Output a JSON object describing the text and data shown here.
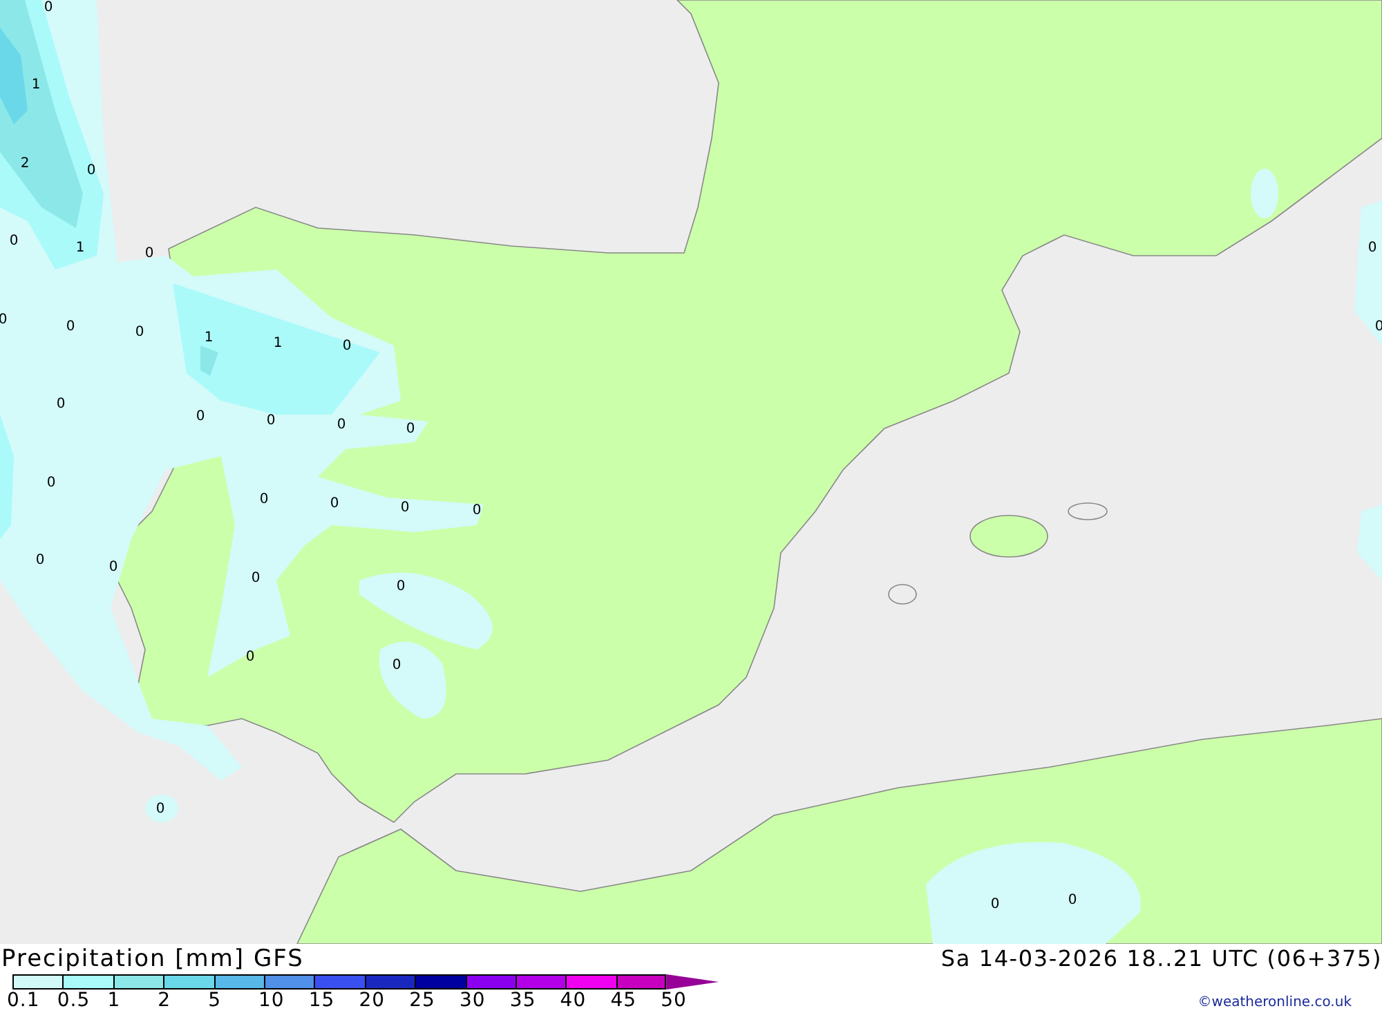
{
  "map": {
    "contour_labels": [
      "0",
      "1",
      "2",
      "0",
      "0",
      "1",
      "0",
      "0",
      "0",
      "0",
      "1",
      "1",
      "0",
      "0",
      "0",
      "0",
      "0",
      "0",
      "0",
      "0",
      "0",
      "0",
      "0",
      "0",
      "0",
      "0",
      "0",
      "0",
      "0",
      "0",
      "0",
      "0",
      "0",
      "0"
    ]
  },
  "legend": {
    "title": "Precipitation [mm] GFS",
    "valid_time": "Sa 14-03-2026 18..21 UTC (06+375)",
    "credit": "©weatheronline.co.uk",
    "classes": [
      {
        "label": "0.1",
        "color": "#d2f8f8"
      },
      {
        "label": "0.5",
        "color": "#aafafa"
      },
      {
        "label": "1",
        "color": "#8ce8e8"
      },
      {
        "label": "2",
        "color": "#6ad8e8"
      },
      {
        "label": "5",
        "color": "#58b8e8"
      },
      {
        "label": "10",
        "color": "#5090e8"
      },
      {
        "label": "15",
        "color": "#3a50f0"
      },
      {
        "label": "20",
        "color": "#1a28c0"
      },
      {
        "label": "25",
        "color": "#0000a0"
      },
      {
        "label": "30",
        "color": "#8c00f0"
      },
      {
        "label": "35",
        "color": "#b400e8"
      },
      {
        "label": "40",
        "color": "#f000f0"
      },
      {
        "label": "45",
        "color": "#c800c0"
      },
      {
        "label": "50",
        "color": "#960096"
      }
    ]
  }
}
